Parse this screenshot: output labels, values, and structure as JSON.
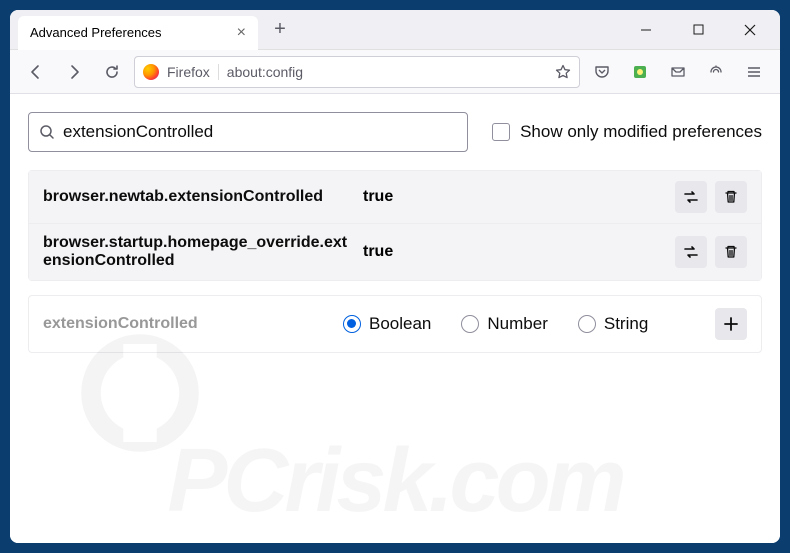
{
  "window": {
    "tab_title": "Advanced Preferences"
  },
  "toolbar": {
    "identity": "Firefox",
    "url": "about:config"
  },
  "search": {
    "value": "extensionControlled",
    "show_modified_label": "Show only modified preferences"
  },
  "prefs": [
    {
      "name": "browser.newtab.extensionControlled",
      "value": "true"
    },
    {
      "name": "browser.startup.homepage_override.extensionControlled",
      "value": "true"
    }
  ],
  "new_pref": {
    "name": "extensionControlled",
    "types": [
      "Boolean",
      "Number",
      "String"
    ],
    "selected": "Boolean"
  },
  "watermark": "PCrisk.com"
}
